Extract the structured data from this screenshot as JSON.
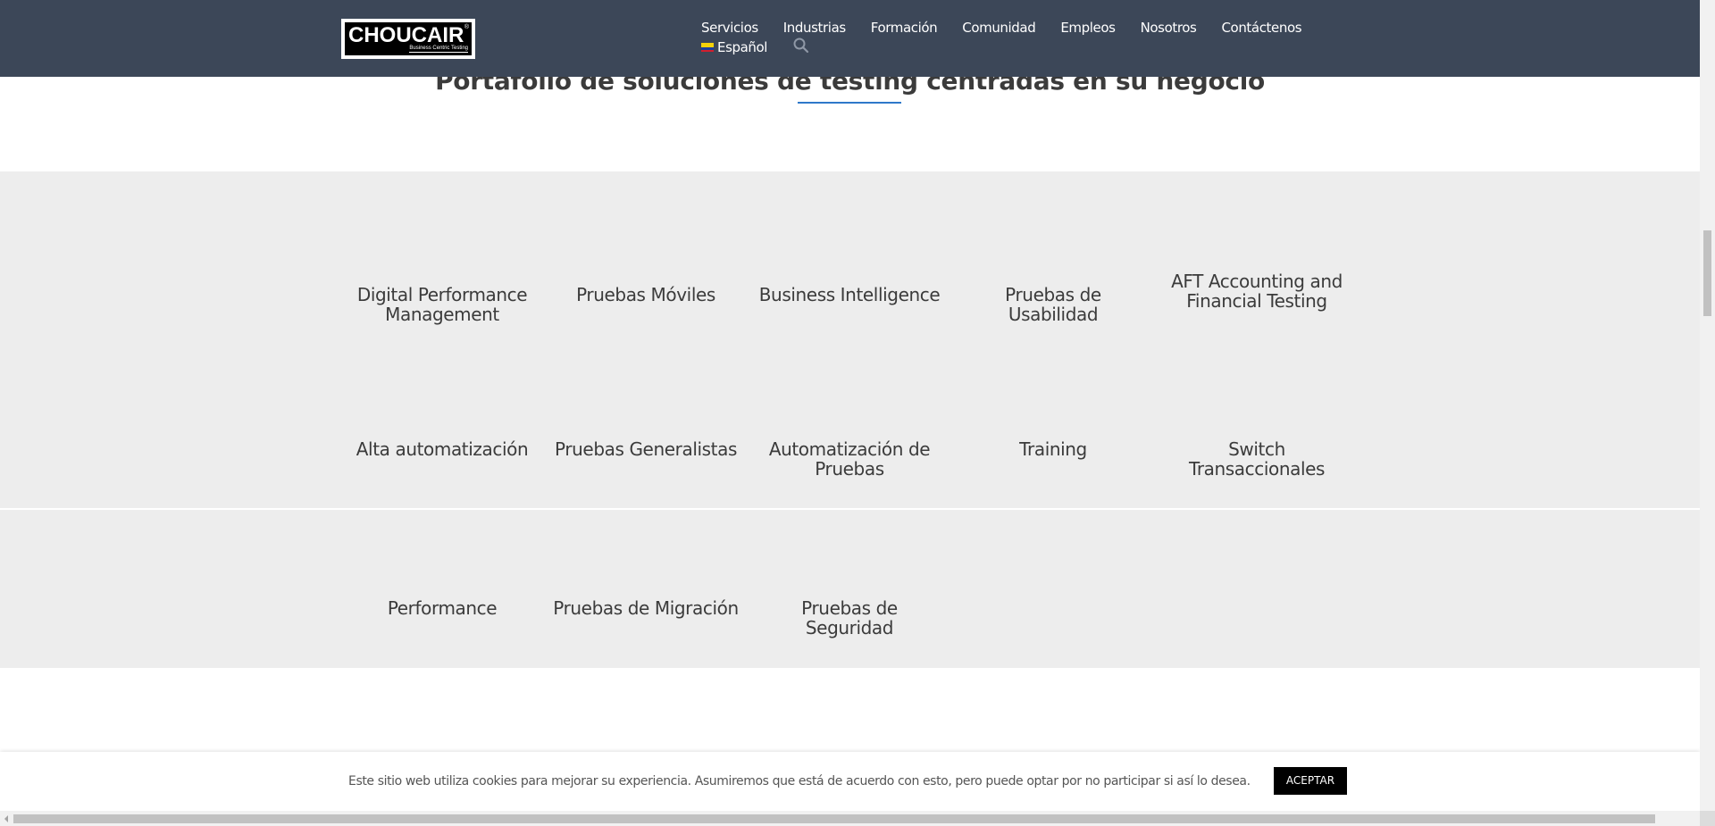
{
  "brand": {
    "name": "CHOUCAIR",
    "reg": "®",
    "tagline": "Business Centric Testing"
  },
  "nav": {
    "items": [
      "Servicios",
      "Industrias",
      "Formación",
      "Comunidad",
      "Empleos",
      "Nosotros",
      "Contáctenos"
    ],
    "language": "Español"
  },
  "section": {
    "title": "Portafolio de soluciones de testing centradas en su negocio"
  },
  "services": [
    [
      "Digital Performance",
      "Management"
    ],
    [
      "Pruebas Móviles"
    ],
    [
      "Business Intelligence"
    ],
    [
      "Pruebas de",
      "Usabilidad"
    ],
    [
      "AFT Accounting and",
      "Financial Testing"
    ],
    [
      "Alta automatización"
    ],
    [
      "Pruebas Generalistas"
    ],
    [
      "Automatización de",
      "Pruebas"
    ],
    [
      "Training"
    ],
    [
      "Switch",
      "Transaccionales"
    ],
    [
      "Performance"
    ],
    [
      "Pruebas de Migración"
    ],
    [
      "Pruebas de",
      "Seguridad"
    ]
  ],
  "cookie": {
    "text": "Este sitio web utiliza cookies para mejorar su experiencia. Asumiremos que está de acuerdo con esto, pero puede optar por no participar si así lo desea.",
    "accept_label": "ACEPTAR"
  },
  "colors": {
    "header_bg": "#3c4758",
    "panel_bg": "#ededed",
    "accent": "#2e78c9"
  }
}
